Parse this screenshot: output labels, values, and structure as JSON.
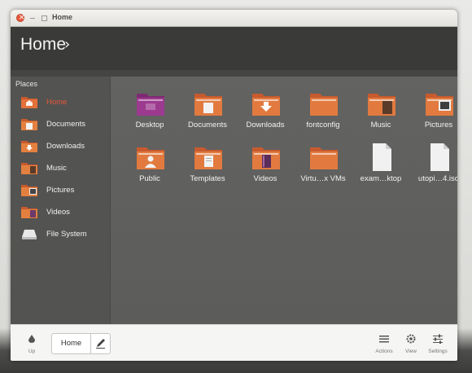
{
  "window": {
    "title": "Home"
  },
  "header": {
    "title": "Home",
    "chevron": "›"
  },
  "sidebar": {
    "section_label": "Places",
    "items": [
      {
        "label": "Home",
        "icon": "home-folder-icon",
        "active": true
      },
      {
        "label": "Documents",
        "icon": "documents-folder-icon"
      },
      {
        "label": "Downloads",
        "icon": "downloads-folder-icon"
      },
      {
        "label": "Music",
        "icon": "music-folder-icon"
      },
      {
        "label": "Pictures",
        "icon": "pictures-folder-icon"
      },
      {
        "label": "Videos",
        "icon": "videos-folder-icon"
      },
      {
        "label": "File System",
        "icon": "drive-icon"
      }
    ]
  },
  "files": [
    {
      "name": "Desktop",
      "icon": "desktop-folder-icon"
    },
    {
      "name": "Documents",
      "icon": "documents-folder-icon"
    },
    {
      "name": "Downloads",
      "icon": "downloads-folder-icon"
    },
    {
      "name": "fontconfig",
      "icon": "folder-icon"
    },
    {
      "name": "Music",
      "icon": "music-folder-icon"
    },
    {
      "name": "Pictures",
      "icon": "pictures-folder-icon"
    },
    {
      "name": "Public",
      "icon": "public-folder-icon"
    },
    {
      "name": "Templates",
      "icon": "templates-folder-icon"
    },
    {
      "name": "Videos",
      "icon": "videos-folder-icon"
    },
    {
      "name": "Virtu…x VMs",
      "icon": "folder-icon"
    },
    {
      "name": "exam…ktop",
      "icon": "file-icon"
    },
    {
      "name": "utopi…4.iso",
      "icon": "file-icon"
    }
  ],
  "bottombar": {
    "up_label": "Up",
    "path_segment": "Home",
    "actions_label": "Actions",
    "view_label": "View",
    "settings_label": "Settings"
  },
  "colors": {
    "accent": "#e8573a",
    "folder_orange": "#e27a3f",
    "header_bg": "#3a3a38",
    "sidebar_bg": "#535351",
    "content_bg": "#606060",
    "bottombar_bg": "#f5f5f4"
  }
}
